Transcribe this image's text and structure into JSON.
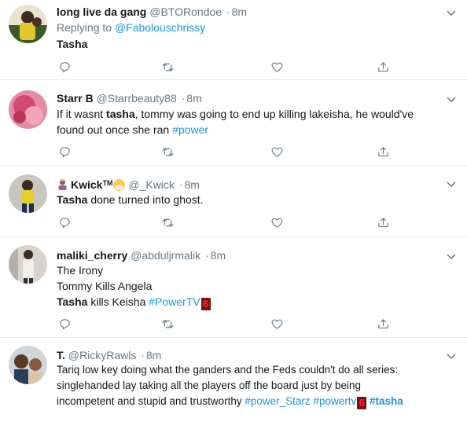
{
  "tweets": [
    {
      "name": "long live da gang",
      "handle": "@BTORondoe",
      "time": "8m",
      "reply_prefix": "Replying to ",
      "reply_to": "@Fabolouschrissy",
      "body_bold": "Tasha"
    },
    {
      "name": "Starr B",
      "handle": "@Starrbeauty88",
      "time": "8m",
      "line1_a": "If it wasnt ",
      "line1_bold": "tasha",
      "line1_b": ",  tommy was going to end up killing lakeisha, he would've",
      "line2_a": "found out once she ran ",
      "line2_link": "#power"
    },
    {
      "name": "Kwick",
      "name_tm": "TM",
      "handle": "@_Kwick",
      "time": "8m",
      "body_bold": "Tasha",
      "body_rest": " done turned into ghost."
    },
    {
      "name": "maliki_cherry",
      "handle": "@abduljrmalik",
      "time": "8m",
      "line1": "The Irony",
      "line2": "Tommy Kills Angela",
      "line3_bold": "Tasha",
      "line3_a": " kills Keisha ",
      "line3_link": "#PowerTV",
      "emoji_text": "6"
    },
    {
      "name": "T.",
      "handle": "@RickyRawls",
      "time": "8m",
      "line1": "Tariq low key doing what the ganders and the Feds couldn't do all series:",
      "line2": "singlehanded lay taking all the players off the board just by being",
      "line3_a": "incompetent and stupid and trustworthy ",
      "line3_link1": "#power_Starz",
      "line3_link2": "#powertv",
      "emoji_text": "6",
      "line3_link3": "#tasha"
    }
  ],
  "separator": "·",
  "colors": {
    "link": "#1b95e0",
    "muted": "#657786",
    "divider": "#e6ecf0"
  },
  "icons": [
    "reply-icon",
    "retweet-icon",
    "like-icon",
    "share-icon",
    "chevron-down-icon"
  ]
}
